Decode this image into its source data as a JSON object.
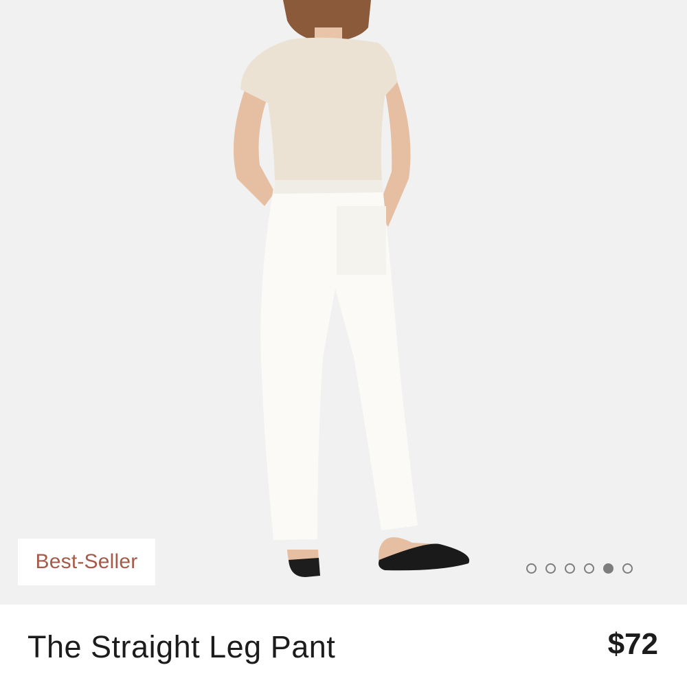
{
  "product": {
    "badge": "Best-Seller",
    "name": "The Straight Leg Pant",
    "price": "$72"
  },
  "carousel": {
    "total": 6,
    "active_index": 4
  },
  "colors": {
    "badge_text": "#a65a49",
    "background": "#f1f1f1",
    "dot": "#7d7d7d"
  }
}
